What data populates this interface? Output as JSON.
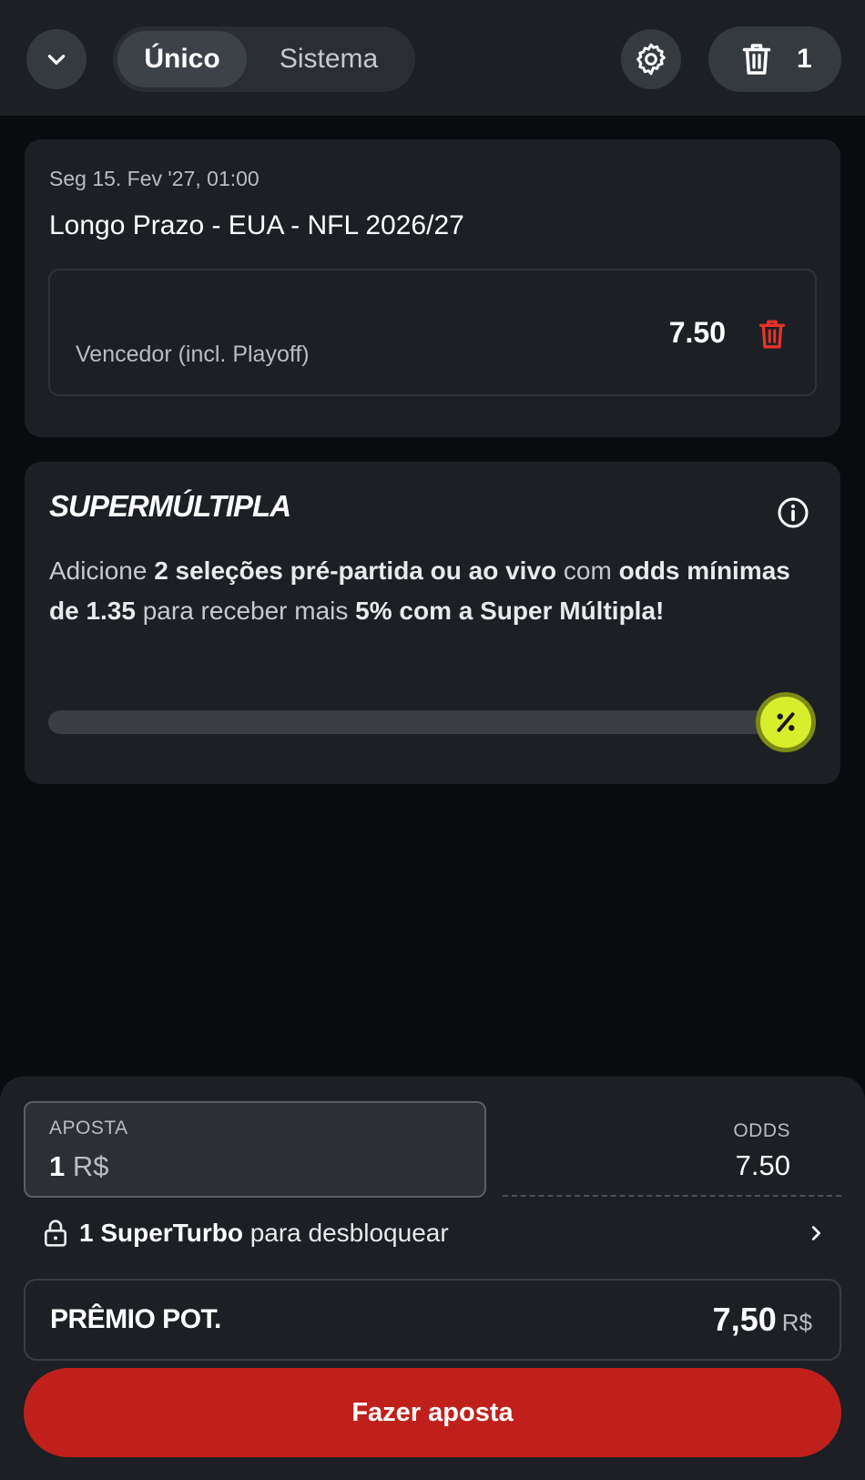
{
  "header": {
    "tabs": [
      {
        "label": "Único",
        "active": true
      },
      {
        "label": "Sistema",
        "active": false
      }
    ],
    "selection_count": "1"
  },
  "event": {
    "date": "Seg 15. Fev '27, 01:00",
    "title": "Longo Prazo - EUA - NFL 2026/27",
    "market": "Vencedor (incl. Playoff)",
    "odds": "7.50"
  },
  "supermultiple": {
    "title": "SUPERMÚLTIPLA",
    "text_parts": [
      "Adicione ",
      "2 seleções pré-partida ou ao vivo",
      " com ",
      "odds mínimas de 1.35",
      " para receber mais ",
      "5% com a Super Múltipla!"
    ],
    "progress_fraction": 0,
    "badge_icon": "percent-icon",
    "badge_color": "#d7ee2c"
  },
  "betslip": {
    "stake_label": "APOSTA",
    "stake_amount": "1",
    "stake_currency": "R$",
    "odds_label": "ODDS",
    "odds_total": "7.50",
    "superturbo_strong": "1 SuperTurbo",
    "superturbo_rest": " para desbloquear",
    "prize_label": "PRÊMIO POT.",
    "prize_value": "7,50",
    "prize_currency": "R$",
    "place_bet_label": "Fazer aposta",
    "place_bet_color": "#c0201c"
  }
}
